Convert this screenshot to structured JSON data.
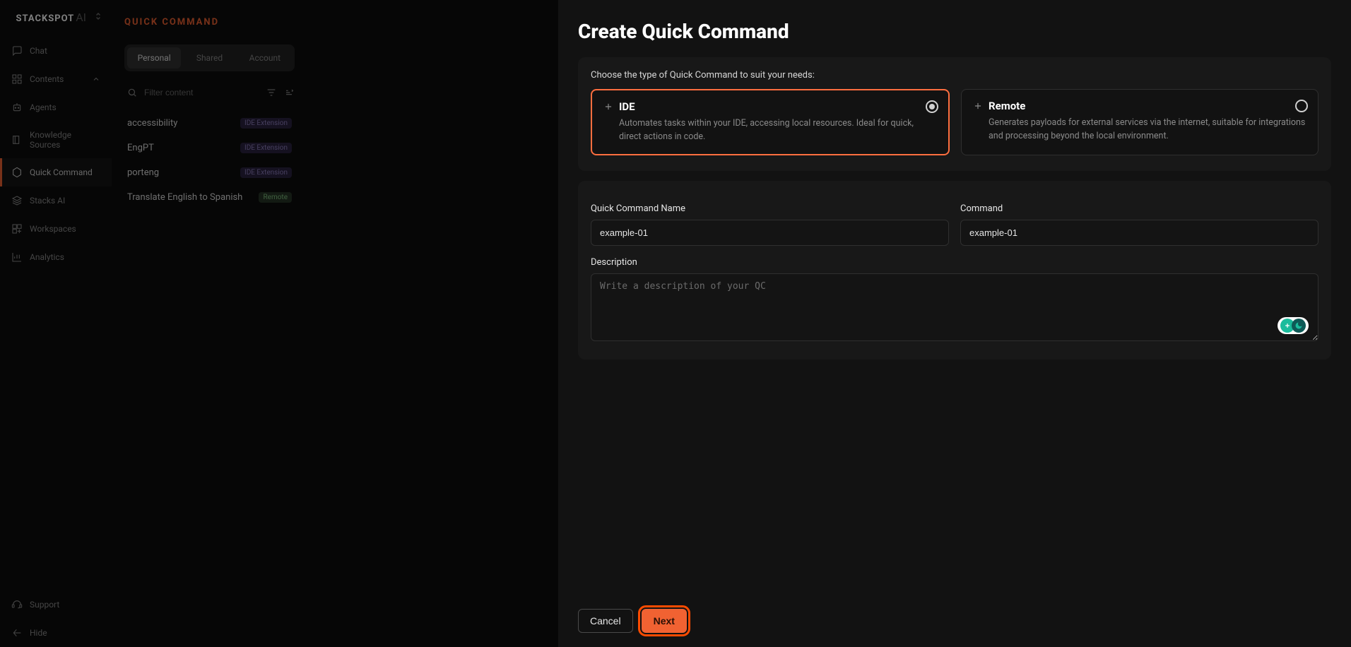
{
  "brand": {
    "name": "STACKSPOT",
    "suffix": "AI"
  },
  "sidebar": {
    "items": [
      {
        "label": "Chat",
        "icon": "chat"
      },
      {
        "label": "Contents",
        "icon": "contents",
        "expanded": true
      },
      {
        "label": "Agents",
        "icon": "agents"
      },
      {
        "label": "Knowledge Sources",
        "icon": "knowledge"
      },
      {
        "label": "Quick Command",
        "icon": "quickcommand",
        "active": true
      },
      {
        "label": "Stacks AI",
        "icon": "stacks"
      },
      {
        "label": "Workspaces",
        "icon": "workspaces"
      },
      {
        "label": "Analytics",
        "icon": "analytics"
      }
    ],
    "support": "Support",
    "hide": "Hide"
  },
  "listpanel": {
    "title": "QUICK COMMAND",
    "tabs": [
      "Personal",
      "Shared",
      "Account"
    ],
    "active_tab": 0,
    "filter_placeholder": "Filter content",
    "items": [
      {
        "name": "accessibility",
        "badge": "IDE Extension",
        "badge_type": "ide"
      },
      {
        "name": "EngPT",
        "badge": "IDE Extension",
        "badge_type": "ide"
      },
      {
        "name": "porteng",
        "badge": "IDE Extension",
        "badge_type": "ide"
      },
      {
        "name": "Translate English to Spanish",
        "badge": "Remote",
        "badge_type": "remote"
      }
    ]
  },
  "modal": {
    "title": "Create Quick Command",
    "choose_label": "Choose the type of Quick Command to suit your needs:",
    "options": [
      {
        "key": "ide",
        "title": "IDE",
        "desc": "Automates tasks within your IDE, accessing local resources. Ideal for quick, direct actions in code.",
        "selected": true
      },
      {
        "key": "remote",
        "title": "Remote",
        "desc": "Generates payloads for external services via the internet, suitable for integrations and processing beyond the local environment.",
        "selected": false
      }
    ],
    "fields": {
      "name_label": "Quick Command Name",
      "name_value": "example-01",
      "command_label": "Command",
      "command_value": "example-01",
      "desc_label": "Description",
      "desc_placeholder": "Write a description of your QC"
    },
    "buttons": {
      "cancel": "Cancel",
      "next": "Next"
    }
  }
}
